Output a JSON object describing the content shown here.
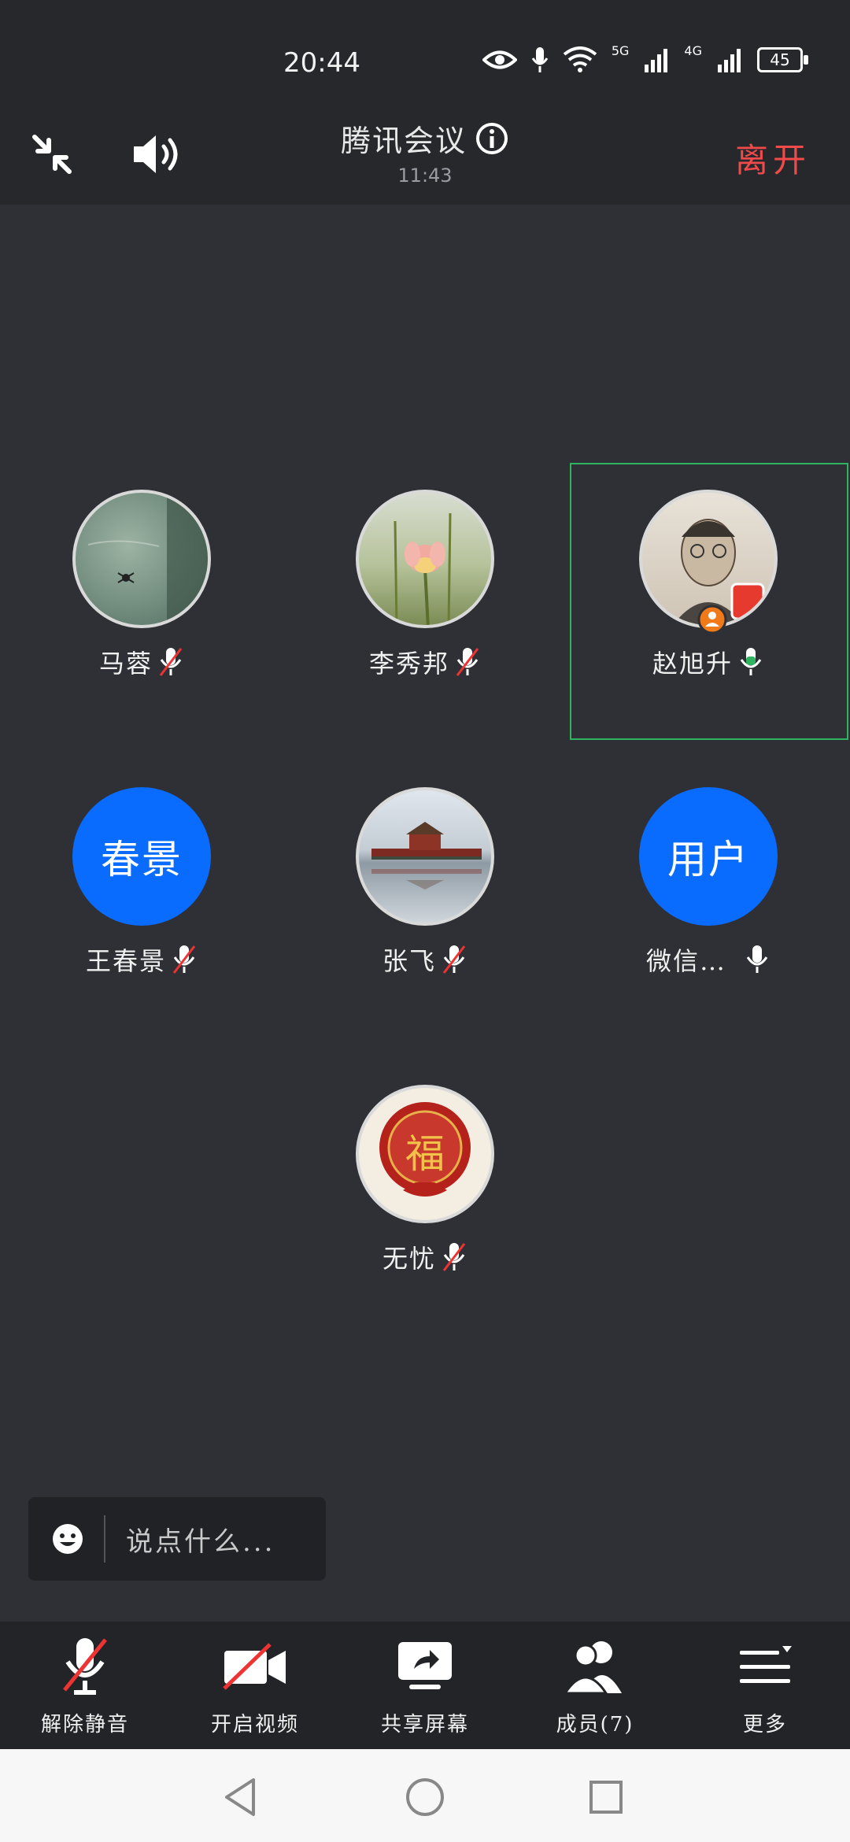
{
  "status_bar": {
    "time": "20:44",
    "network_labels": [
      "5G",
      "4G"
    ],
    "battery": "45",
    "icons": [
      "eye-icon",
      "mic-icon",
      "wifi-icon",
      "signal-icon",
      "signal-icon",
      "battery-icon"
    ]
  },
  "header": {
    "title": "腾讯会议",
    "timer": "11:43",
    "leave_label": "离开",
    "left_icons": [
      "collapse-icon",
      "speaker-icon"
    ],
    "info_icon": "info-icon"
  },
  "participants": [
    {
      "name": "马蓉",
      "avatar": "photo",
      "muted": true
    },
    {
      "name": "李秀邦",
      "avatar": "photo",
      "muted": true
    },
    {
      "name": "赵旭升",
      "avatar": "photo",
      "muted": false,
      "speaking": true,
      "host_badge": true
    },
    {
      "name": "王春景",
      "avatar_text": "春景",
      "muted": true
    },
    {
      "name": "张飞",
      "avatar": "photo",
      "muted": true
    },
    {
      "name": "微信…",
      "avatar_text": "用户",
      "muted": false
    },
    {
      "name": "无忧",
      "avatar": "photo",
      "avatar_glyph": "福",
      "muted": true
    }
  ],
  "chat": {
    "placeholder": "说点什么...",
    "emoji_icon": "emoji-icon"
  },
  "toolbar": {
    "items": [
      {
        "label": "解除静音",
        "icon": "mic-muted-icon"
      },
      {
        "label": "开启视频",
        "icon": "video-off-icon"
      },
      {
        "label": "共享屏幕",
        "icon": "share-screen-icon"
      },
      {
        "label": "成员(7)",
        "icon": "members-icon"
      },
      {
        "label": "更多",
        "icon": "more-icon"
      }
    ]
  },
  "colors": {
    "accent_blue": "#0a6cff",
    "leave_red": "#f04a4a",
    "speaking_green": "#2fb45f",
    "background": "#2e3035"
  }
}
